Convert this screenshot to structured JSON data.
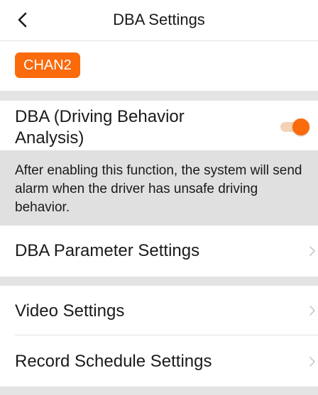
{
  "header": {
    "title": "DBA Settings",
    "back_icon": "chevron-left-icon"
  },
  "channel": {
    "label": "CHAN2"
  },
  "dba": {
    "label": "DBA (Driving Behavior Analysis)",
    "enabled": true,
    "description": "After enabling this function, the system will send alarm when the driver has unsafe driving behavior."
  },
  "menu": {
    "parameter_settings": "DBA Parameter Settings",
    "video_settings": "Video Settings",
    "record_schedule_settings": "Record Schedule Settings",
    "chevron_icon": "chevron-right-icon"
  },
  "colors": {
    "accent": "#fb6a0b",
    "section_gap": "#e4e4e4",
    "description_bg": "#e0e0e0"
  }
}
